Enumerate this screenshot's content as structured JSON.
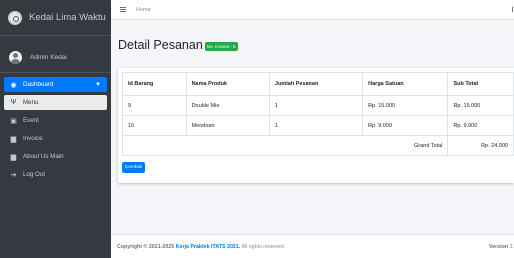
{
  "brand": {
    "name": "Kedai Lima Waktu",
    "logo_icon": "logo-icon"
  },
  "user": {
    "name": "Admin Kedai"
  },
  "nav": {
    "items": [
      {
        "label": "Dashboard",
        "icon": "palette-icon"
      },
      {
        "label": "Menu",
        "icon": "utensils-icon"
      },
      {
        "label": "Event",
        "icon": "calendar-icon"
      },
      {
        "label": "Invoice",
        "icon": "file-icon"
      },
      {
        "label": "About Us Main",
        "icon": "file-icon"
      },
      {
        "label": "Log Out",
        "icon": "sign-out-icon"
      }
    ]
  },
  "topbar": {
    "home": "Home"
  },
  "header": {
    "title": "Detail Pesanan",
    "badge": "No. Invoice : 5"
  },
  "table": {
    "headers": [
      "Id Barang",
      "Nama Produk",
      "Jumlah Pesanan",
      "Harga Satuan",
      "Sub Total"
    ],
    "rows": [
      [
        "9",
        "Double Mie",
        "1",
        "Rp. 15.000",
        "Rp. 15.000"
      ],
      [
        "10",
        "Mendoan",
        "1",
        "Rp. 9.000",
        "Rp. 9.000"
      ]
    ],
    "grand_total_label": "Grand Total",
    "grand_total_value": "Rp. 24.000"
  },
  "buttons": {
    "kembali": "Kembali"
  },
  "footer": {
    "copyright_prefix": "Copyright © 2021-2025",
    "copyright_link": "Kerja Praktek ITATS 2021.",
    "copyright_suffix": "All rights reserved.",
    "version_label": "Version",
    "version_value": "3."
  },
  "colors": {
    "sidebar": "#343a40",
    "primary": "#007bff",
    "success": "#28a745",
    "background": "#f4f6f9"
  }
}
